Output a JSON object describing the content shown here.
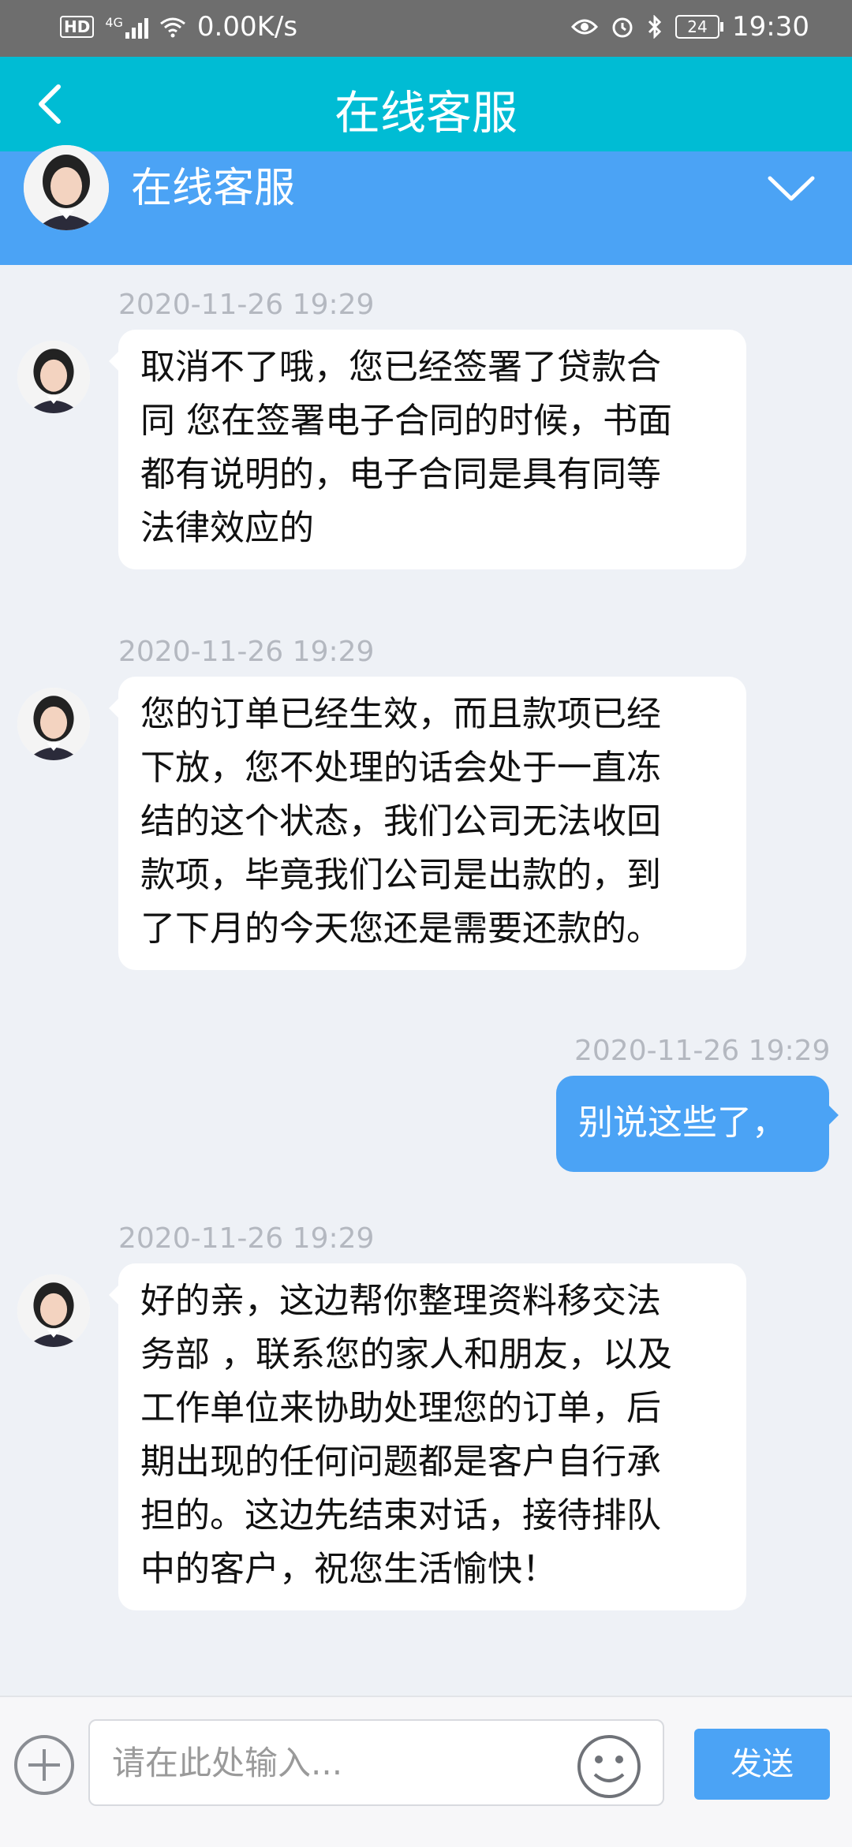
{
  "status_bar": {
    "hd": "HD",
    "network": "4G",
    "speed": "0.00K/s",
    "battery": "24",
    "time": "19:30"
  },
  "app_bar": {
    "title": "在线客服"
  },
  "agent": {
    "name": "在线客服"
  },
  "messages": [
    {
      "time": "2020-11-26 19:29",
      "direction": "in",
      "lines": [
        "取消不了哦，您已经签署了贷款合",
        "同 您在签署电子合同的时候，书面",
        "都有说明的，电子合同是具有同等",
        "法律效应的"
      ]
    },
    {
      "time": "2020-11-26 19:29",
      "direction": "in",
      "lines": [
        "您的订单已经生效，而且款项已经",
        "下放，您不处理的话会处于一直冻",
        "结的这个状态，我们公司无法收回",
        "款项，毕竟我们公司是出款的，到",
        "了下月的今天您还是需要还款的。"
      ]
    },
    {
      "time": "2020-11-26 19:29",
      "direction": "out",
      "lines": [
        "别说这些了，"
      ]
    },
    {
      "time": "2020-11-26 19:29",
      "direction": "in",
      "lines": [
        "好的亲，这边帮你整理资料移交法",
        "务部 ，联系您的家人和朋友，以及",
        "工作单位来协助处理您的订单，后",
        "期出现的任何问题都是客户自行承",
        "担的。这边先结束对话，接待排队",
        "中的客户，祝您生活愉快！"
      ]
    }
  ],
  "input": {
    "placeholder": "请在此处输入...",
    "send_label": "发送"
  },
  "colors": {
    "app_bar": "#00bcd4",
    "accent": "#4ba3f5",
    "background": "#eef1f6"
  }
}
